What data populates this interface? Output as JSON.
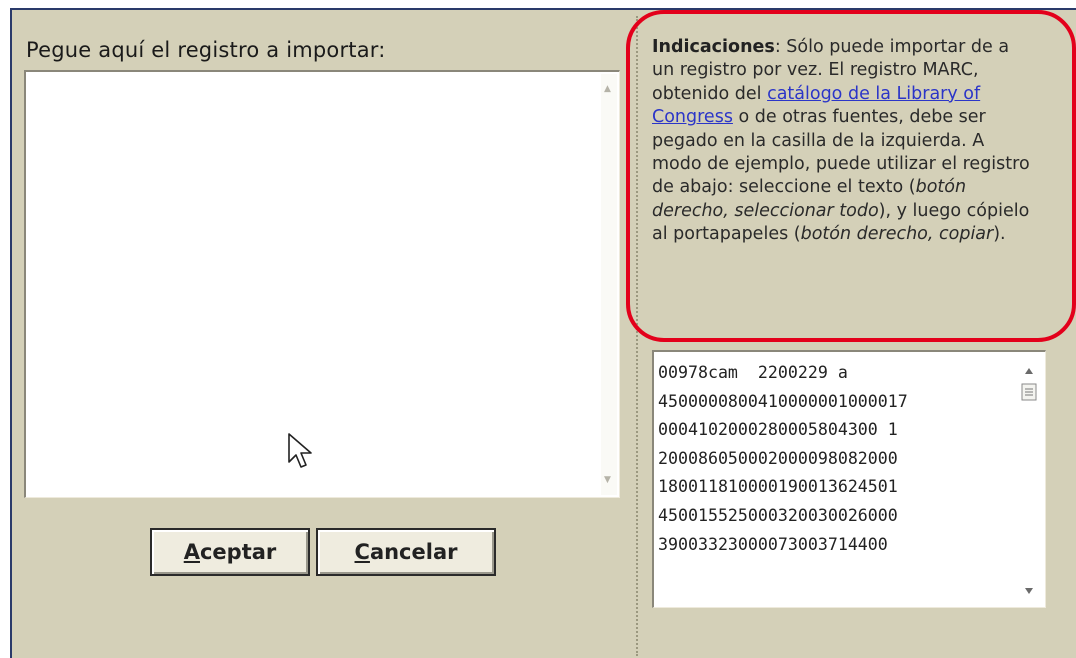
{
  "left": {
    "label": "Pegue aquí el registro a importar:",
    "textarea_value": ""
  },
  "buttons": {
    "accept": {
      "mnemonic": "A",
      "rest": "ceptar"
    },
    "cancel": {
      "mnemonic": "C",
      "rest": "ancelar"
    }
  },
  "instructions": {
    "title": "Indicaciones",
    "part1": ": Sólo puede importar de a un registro por vez. El registro MARC, obtenido del ",
    "link": "catálogo de la Library of Congress",
    "part2": " o de otras fuentes, debe ser pegado en la casilla de la izquierda. A modo de ejemplo, puede utilizar el registro de abajo: seleccione el texto (",
    "em1": "botón derecho, seleccionar todo",
    "part3": "), y luego cópielo al portapapeles (",
    "em2": "botón derecho, copiar",
    "part4": ")."
  },
  "marc_sample": {
    "lines": [
      "00978cam  2200229 a",
      "4500000800410000001000017",
      "0004102000280005804300 1",
      "200086050002000098082000",
      "180011810000190013624501",
      "450015525000320030026000",
      "39003323000073003714400"
    ]
  },
  "colors": {
    "panel_bg": "#d4d0b8",
    "highlight_border": "#e3001b",
    "link": "#2b35c8"
  }
}
